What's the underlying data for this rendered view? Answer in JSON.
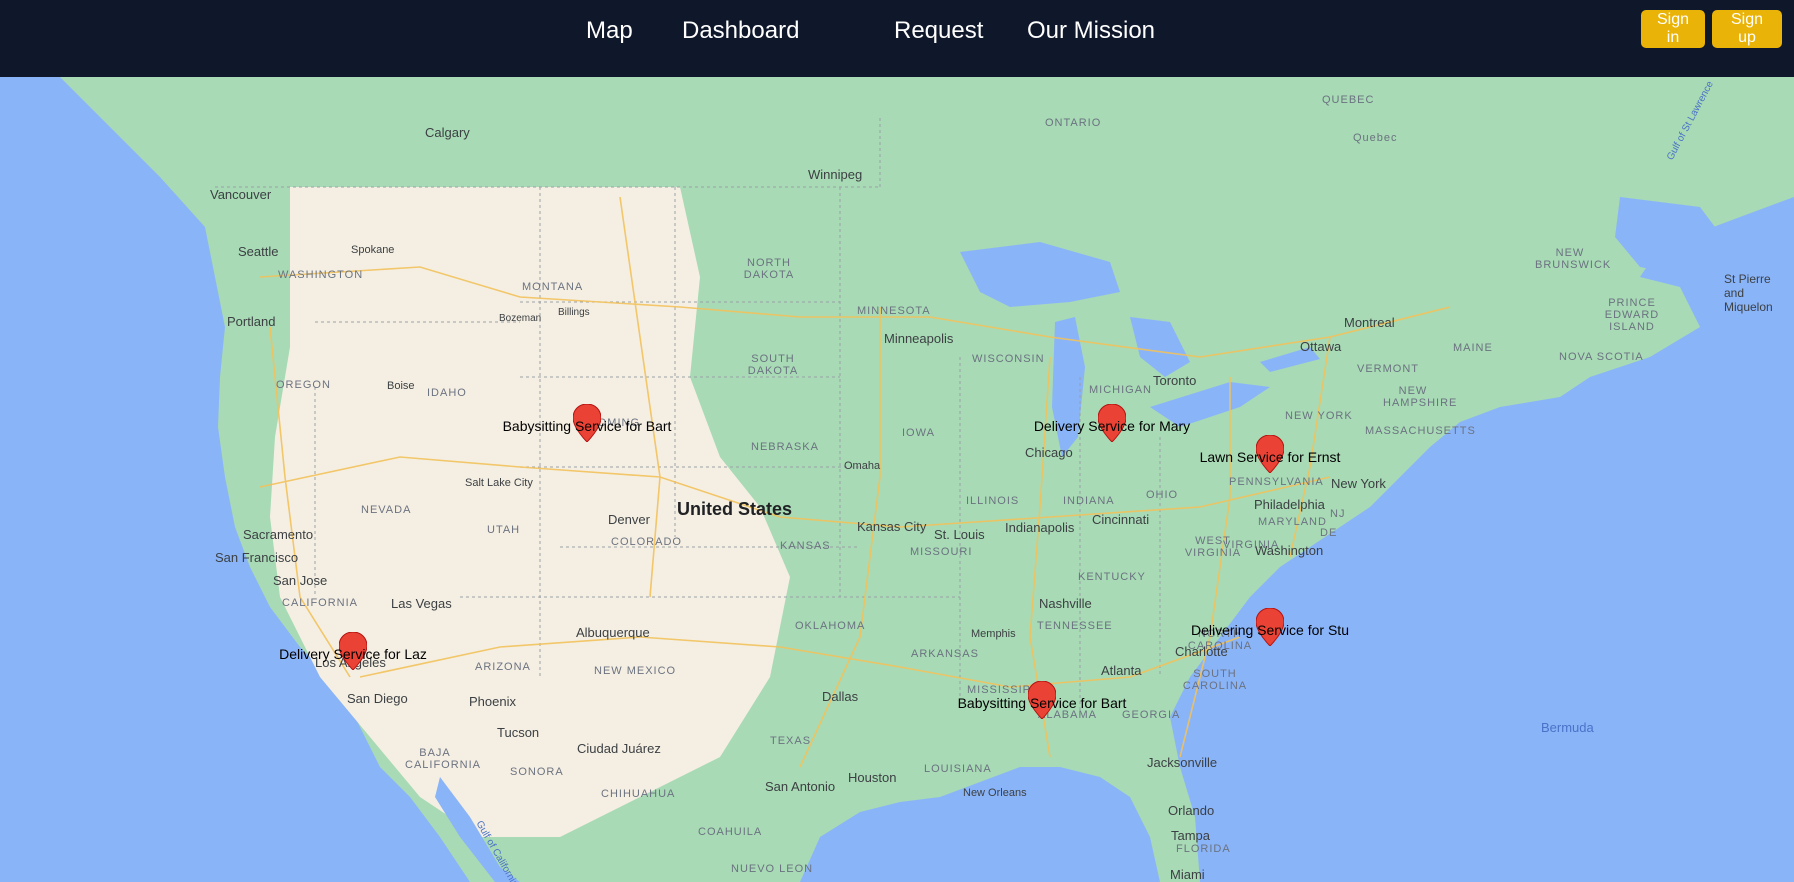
{
  "nav": {
    "links": [
      "Map",
      "Dashboard",
      "Request",
      "Our Mission"
    ],
    "sign_in": "Sign in",
    "sign_up": "Sign up"
  },
  "colors": {
    "navbar": "#0f172a",
    "button": "#eab308",
    "water": "#8ab4f8",
    "land": "#a8dab5",
    "marker": "#ea4335"
  },
  "markers": [
    {
      "label": "Babysitting Service for Bart"
    },
    {
      "label": "Delivery Service for Mary"
    },
    {
      "label": "Lawn Service for Ernst"
    },
    {
      "label": "Delivering Service for Stu"
    },
    {
      "label": "Delivery Service for Laz"
    },
    {
      "label": "Babysitting Service for Bart"
    }
  ],
  "map_labels": {
    "country": "United States",
    "cities": [
      "Calgary",
      "Vancouver",
      "Seattle",
      "Spokane",
      "Portland",
      "Boise",
      "Bozeman",
      "Billings",
      "Winnipeg",
      "Minneapolis",
      "Chicago",
      "Toronto",
      "Ottawa",
      "Montreal",
      "Quebec",
      "New York",
      "Philadelphia",
      "Washington",
      "Salt Lake City",
      "Denver",
      "Omaha",
      "Kansas City",
      "St. Louis",
      "Indianapolis",
      "Cincinnati",
      "Nashville",
      "Memphis",
      "Atlanta",
      "Charlotte",
      "Sacramento",
      "San Francisco",
      "San Jose",
      "Las Vegas",
      "Los Angeles",
      "San Diego",
      "Phoenix",
      "Tucson",
      "Albuquerque",
      "Ciudad Juárez",
      "Dallas",
      "San Antonio",
      "Houston",
      "New Orleans",
      "Jacksonville",
      "Orlando",
      "Tampa",
      "Miami",
      "St Pierre and Miquelon"
    ],
    "states": [
      "ONTARIO",
      "QUEBEC",
      "WASHINGTON",
      "MONTANA",
      "NORTH DAKOTA",
      "MINNESOTA",
      "SOUTH DAKOTA",
      "WISCONSIN",
      "MICHIGAN",
      "OREGON",
      "IDAHO",
      "WYOMING",
      "NEBRASKA",
      "IOWA",
      "ILLINOIS",
      "INDIANA",
      "OHIO",
      "PENNSYLVANIA",
      "NEW YORK",
      "NEVADA",
      "UTAH",
      "COLORADO",
      "KANSAS",
      "MISSOURI",
      "KENTUCKY",
      "WEST VIRGINIA",
      "VIRGINIA",
      "MARYLAND",
      "DE",
      "NJ",
      "CALIFORNIA",
      "ARIZONA",
      "NEW MEXICO",
      "OKLAHOMA",
      "ARKANSAS",
      "TENNESSEE",
      "NORTH CAROLINA",
      "SOUTH CAROLINA",
      "MISSISSIPPI",
      "ALABAMA",
      "GEORGIA",
      "LOUISIANA",
      "TEXAS",
      "FLORIDA",
      "BAJA CALIFORNIA",
      "SONORA",
      "CHIHUAHUA",
      "COAHUILA",
      "NUEVO LEON",
      "NEW BRUNSWICK",
      "PRINCE EDWARD ISLAND",
      "NOVA SCOTIA",
      "MAINE",
      "VERMONT",
      "NEW HAMPSHIRE",
      "MASSACHUSETTS"
    ],
    "water": [
      "Bermuda",
      "Gulf of St Lawrence",
      "Gulf of California"
    ]
  }
}
